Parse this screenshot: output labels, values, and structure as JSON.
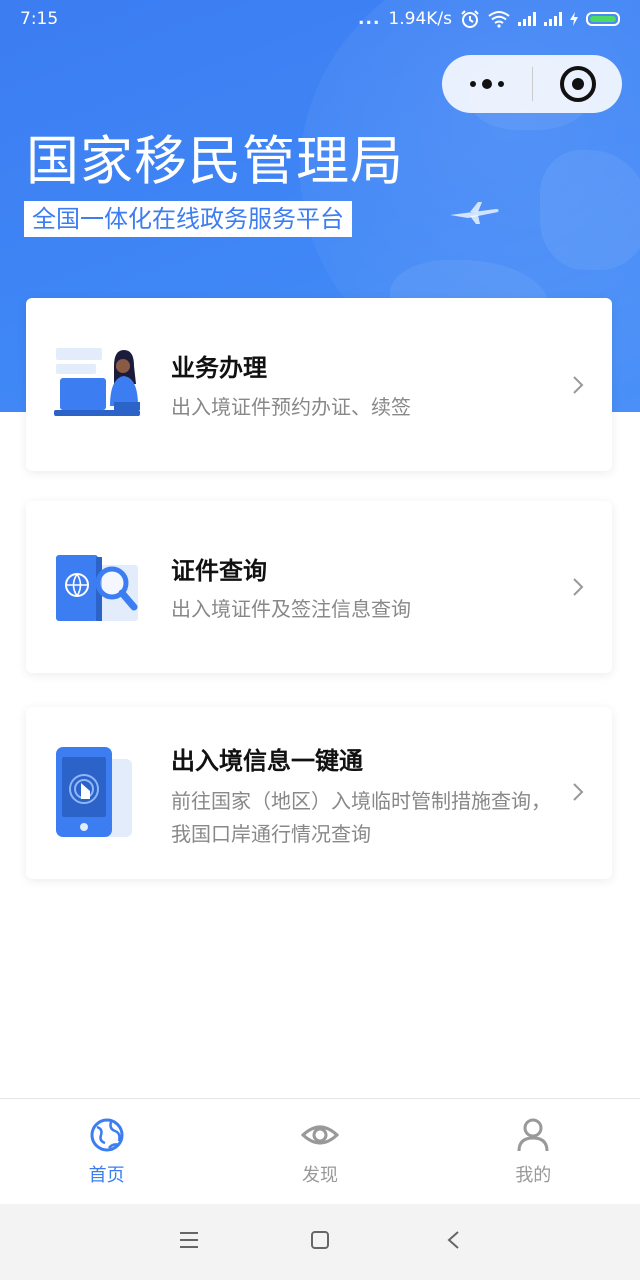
{
  "status_bar": {
    "time": "7:15",
    "signal_dots": "...",
    "network_speed": "1.94K/s",
    "icons": [
      "alarm-icon",
      "wifi-icon",
      "signal-icon",
      "signal-icon",
      "charging-icon",
      "battery-icon"
    ]
  },
  "capsule": {
    "icons": [
      "more-icon",
      "close-miniprogram-icon"
    ]
  },
  "hero": {
    "title": "国家移民管理局",
    "subtitle": "全国一体化在线政务服务平台"
  },
  "cards": [
    {
      "title": "业务办理",
      "desc": "出入境证件预约办证、续签",
      "icon": "business-handling-illustration"
    },
    {
      "title": "证件查询",
      "desc": "出入境证件及签注信息查询",
      "icon": "document-search-illustration"
    },
    {
      "title": "出入境信息一键通",
      "desc": "前往国家（地区）入境临时管制措施查询，我国口岸通行情况查询",
      "icon": "phone-touch-illustration"
    }
  ],
  "tabbar": {
    "items": [
      {
        "label": "首页",
        "icon": "globe-icon",
        "active": true
      },
      {
        "label": "发现",
        "icon": "eye-icon",
        "active": false
      },
      {
        "label": "我的",
        "icon": "user-icon",
        "active": false
      }
    ]
  },
  "colors": {
    "primary": "#3c7df2",
    "tab_active": "#3c7df2",
    "tab_inactive": "#999999",
    "card_desc": "#888888"
  }
}
